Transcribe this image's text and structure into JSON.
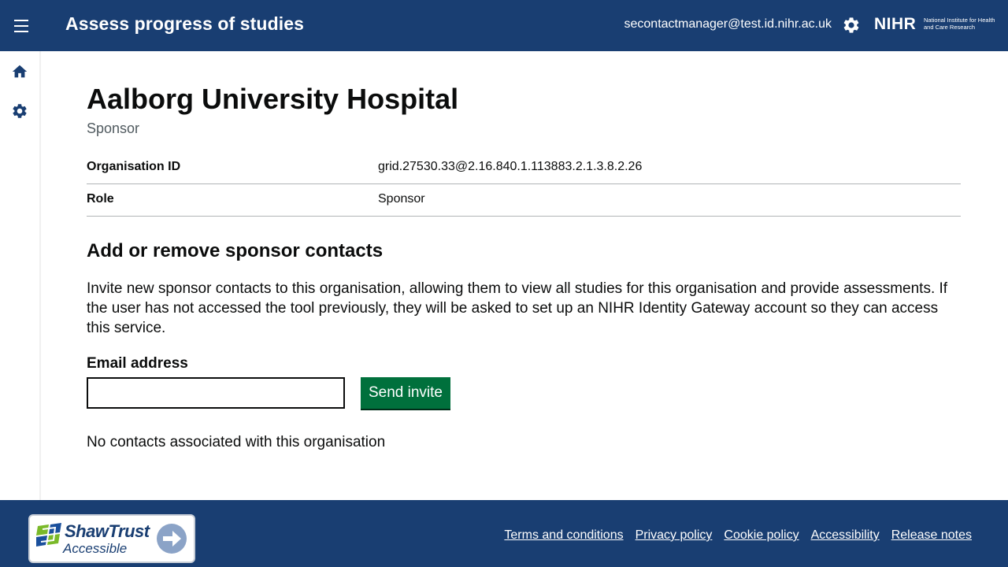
{
  "header": {
    "title": "Assess progress of studies",
    "user_email": "secontactmanager@test.id.nihr.ac.uk",
    "logo_mark": "NIHR",
    "logo_subtitle": "National Institute for Health and Care Research",
    "icons": {
      "menu": "hamburger-icon",
      "settings": "gear-icon"
    }
  },
  "sidebar": {
    "items": [
      {
        "icon": "home-icon"
      },
      {
        "icon": "gear-icon"
      }
    ]
  },
  "main": {
    "org_name": "Aalborg University Hospital",
    "org_role": "Sponsor",
    "summary": [
      {
        "key": "Organisation ID",
        "value": "grid.27530.33@2.16.840.1.113883.2.1.3.8.2.26"
      },
      {
        "key": "Role",
        "value": "Sponsor"
      }
    ],
    "section_heading": "Add or remove sponsor contacts",
    "intro": "Invite new sponsor contacts to this organisation, allowing them to view all studies for this organisation and provide assessments. If the user has not accessed the tool previously, they will be asked to set up an NIHR Identity Gateway account so they can access this service.",
    "email_label": "Email address",
    "email_value": "",
    "send_button": "Send invite",
    "no_contacts": "No contacts associated with this organisation"
  },
  "footer": {
    "badge_title": "ShawTrust",
    "badge_subtitle": "Accessible",
    "links": [
      "Terms and conditions",
      "Privacy policy",
      "Cookie policy",
      "Accessibility",
      "Release notes"
    ]
  },
  "colors": {
    "header_bg": "#193e72",
    "button_green": "#00703c",
    "secondary_text": "#505a5f"
  }
}
